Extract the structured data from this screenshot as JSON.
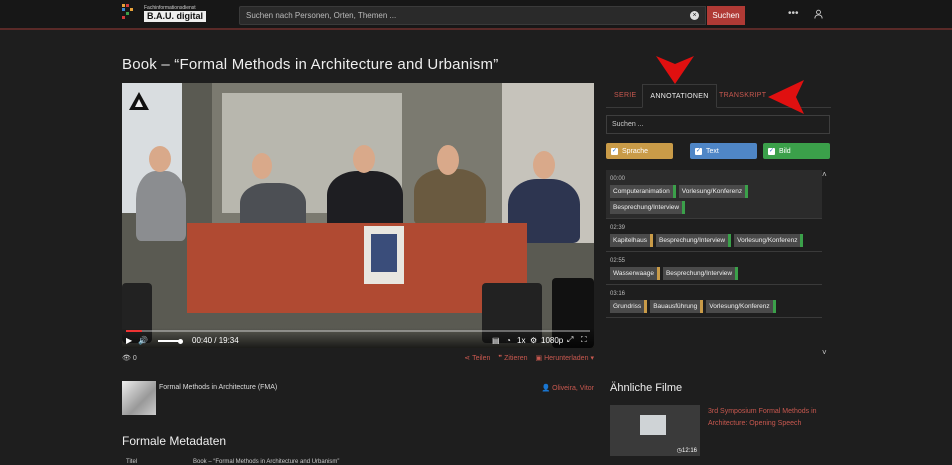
{
  "header": {
    "logo_small": "Fachinformationsdienst",
    "logo_big": "B.A.U. digital",
    "search_placeholder": "Suchen nach Personen, Orten, Themen ...",
    "search_button": "Suchen"
  },
  "page": {
    "title": "Book – “Formal Methods in Architecture and Urbanism”"
  },
  "player": {
    "time": "00:40 / 19:34",
    "speed": "1x",
    "quality": "1080p",
    "progress_fraction": 0.034
  },
  "below_video": {
    "views": "0",
    "share": "Teilen",
    "cite": "Zitieren",
    "download": "Herunterladen"
  },
  "series": {
    "title": "Formal Methods in Architecture (FMA)",
    "author": "Oliveira, Vitor"
  },
  "metadata": {
    "heading": "Formale Metadaten",
    "title_label": "Titel",
    "title_value": "Book – “Formal Methods in Architecture and Urbanism”"
  },
  "tabs": {
    "serie": "SERIE",
    "annotationen": "ANNOTATIONEN",
    "transkript": "TRANSKRIPT"
  },
  "annotations": {
    "search_placeholder": "Suchen ...",
    "filters": {
      "sprache": "Sprache",
      "text": "Text",
      "bild": "Bild"
    },
    "items": [
      {
        "time": "00:00",
        "tags": [
          "Computeranimation",
          "Vorlesung/Konferenz",
          "Besprechung/Interview"
        ]
      },
      {
        "time": "02:39",
        "tags": [
          "Kapitelhaus",
          "Besprechung/Interview",
          "Vorlesung/Konferenz"
        ]
      },
      {
        "time": "02:55",
        "tags": [
          "Wasserwaage",
          "Besprechung/Interview"
        ]
      },
      {
        "time": "03:16",
        "tags": [
          "Grundriss",
          "Bauausführung",
          "Vorlesung/Konferenz"
        ]
      }
    ]
  },
  "similar": {
    "heading": "Ähnliche Filme",
    "items": [
      {
        "title": "3rd Symposium Formal Methods in Architecture: Opening Speech",
        "duration": "12:16"
      }
    ]
  },
  "colors": {
    "accent": "#c8584f",
    "sprache": "#c99b48",
    "text": "#4f86c6",
    "bild": "#3ba04a"
  }
}
